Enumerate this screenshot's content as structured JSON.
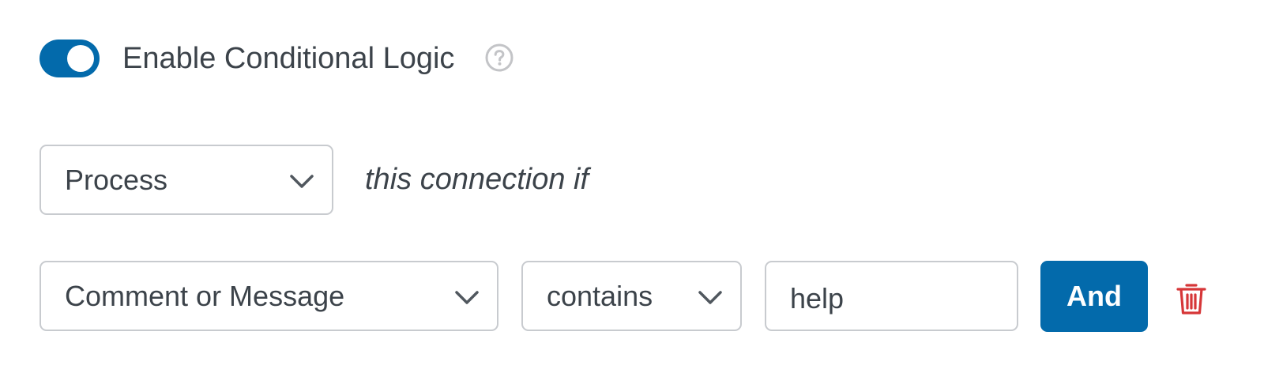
{
  "colors": {
    "accent": "#036aab",
    "muted_icon": "#c3c4c7",
    "danger": "#d63638",
    "chevron": "#50575e"
  },
  "conditional_logic": {
    "toggle_on": true,
    "toggle_label": "Enable Conditional Logic",
    "help_icon": "question-circle-icon"
  },
  "rule_header": {
    "action_value": "Process",
    "suffix": "this connection if"
  },
  "rule": {
    "field_value": "Comment or Message",
    "operator_value": "contains",
    "input_value": "help",
    "and_label": "And",
    "delete_icon": "trash-icon"
  }
}
